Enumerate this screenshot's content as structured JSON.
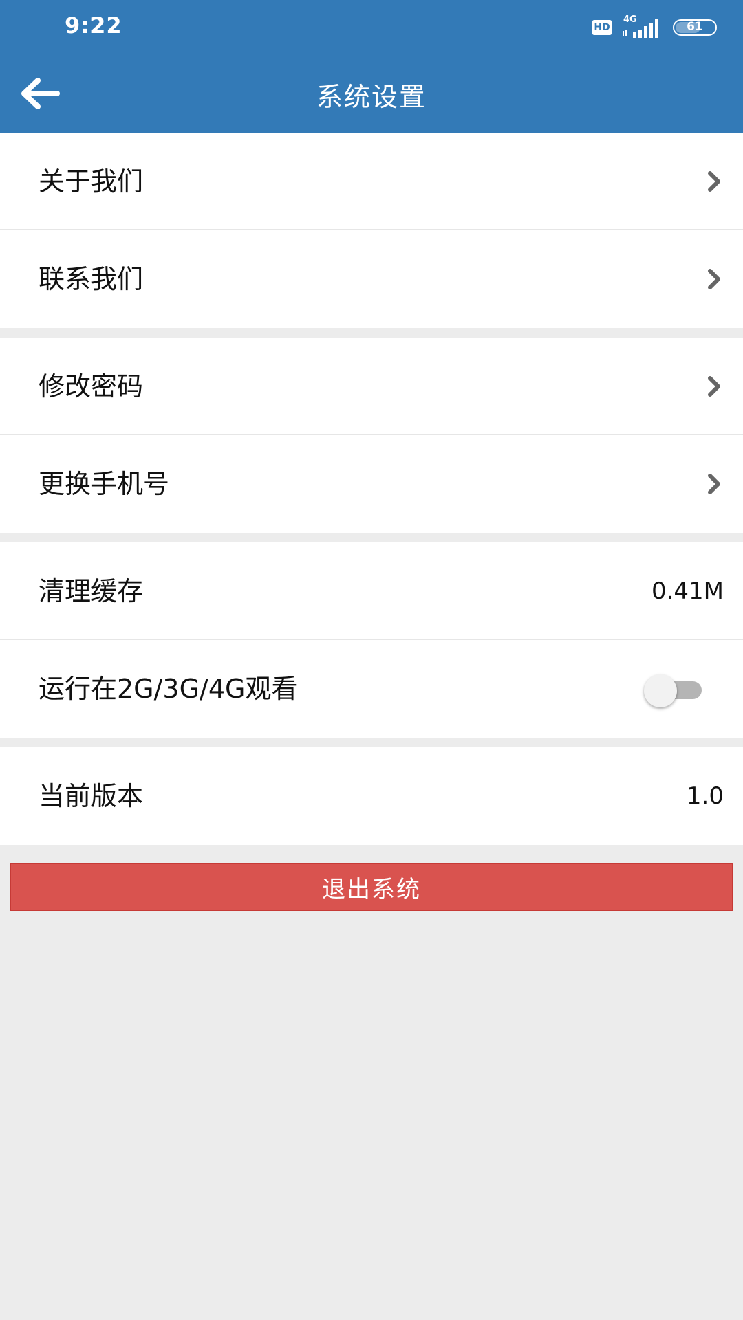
{
  "status_bar": {
    "time": "9:22",
    "hd_label": "HD",
    "network_label": "4G",
    "battery_level": "61"
  },
  "header": {
    "title": "系统设置",
    "back_icon": "arrow-left-icon"
  },
  "groups": {
    "about": {
      "about_us": "关于我们",
      "contact_us": "联系我们"
    },
    "account": {
      "change_password": "修改密码",
      "change_phone": "更换手机号"
    },
    "storage": {
      "clear_cache": "清理缓存",
      "cache_size": "0.41M",
      "mobile_network_playback": "运行在2G/3G/4G观看",
      "mobile_network_enabled": false
    },
    "version": {
      "label": "当前版本",
      "value": "1.0"
    }
  },
  "logout": {
    "label": "退出系统"
  },
  "colors": {
    "primary": "#337ab7",
    "danger": "#d9534f",
    "background": "#ececec"
  }
}
